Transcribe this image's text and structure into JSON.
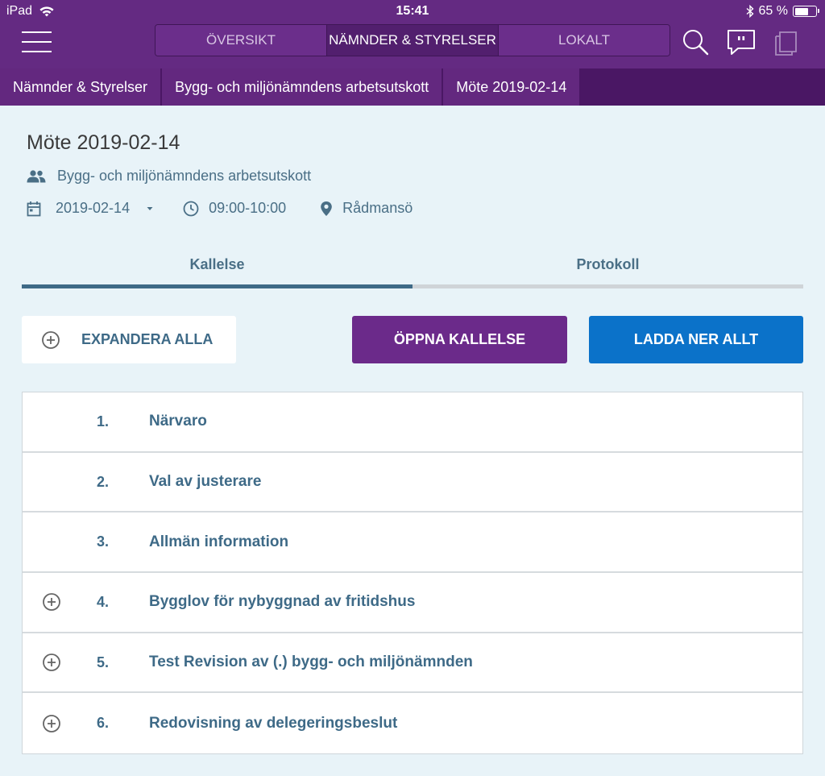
{
  "status": {
    "device": "iPad",
    "time": "15:41",
    "battery": "65 %",
    "battery_level": 0.65
  },
  "nav": {
    "tabs": [
      "ÖVERSIKT",
      "NÄMNDER & STYRELSER",
      "LOKALT"
    ],
    "active_tab": 1
  },
  "breadcrumb": [
    "Nämnder & Styrelser",
    "Bygg- och miljönämndens arbetsutskott",
    "Möte 2019-02-14"
  ],
  "meeting": {
    "title": "Möte 2019-02-14",
    "committee": "Bygg- och miljönämndens arbetsutskott",
    "date": "2019-02-14",
    "time": "09:00-10:00",
    "location": "Rådmansö"
  },
  "tabs": {
    "kallelse": "Kallelse",
    "protokoll": "Protokoll"
  },
  "buttons": {
    "expand": "EXPANDERA ALLA",
    "open": "ÖPPNA KALLELSE",
    "download": "LADDA NER ALLT"
  },
  "agenda": [
    {
      "num": "1.",
      "label": "Närvaro",
      "expandable": false
    },
    {
      "num": "2.",
      "label": "Val av justerare",
      "expandable": false
    },
    {
      "num": "3.",
      "label": "Allmän information",
      "expandable": false
    },
    {
      "num": "4.",
      "label": "Bygglov för nybyggnad av fritidshus",
      "expandable": true
    },
    {
      "num": "5.",
      "label": "Test Revision av (.) bygg- och miljönämnden",
      "expandable": true
    },
    {
      "num": "6.",
      "label": "Redovisning av delegeringsbeslut",
      "expandable": true
    }
  ],
  "colors": {
    "header": "#642a82",
    "breadcrumb": "#4a1764",
    "open_button": "#6b2a8a",
    "download_button": "#0b72c9",
    "text_accent": "#3e6a87",
    "background": "#e8f3f8"
  }
}
